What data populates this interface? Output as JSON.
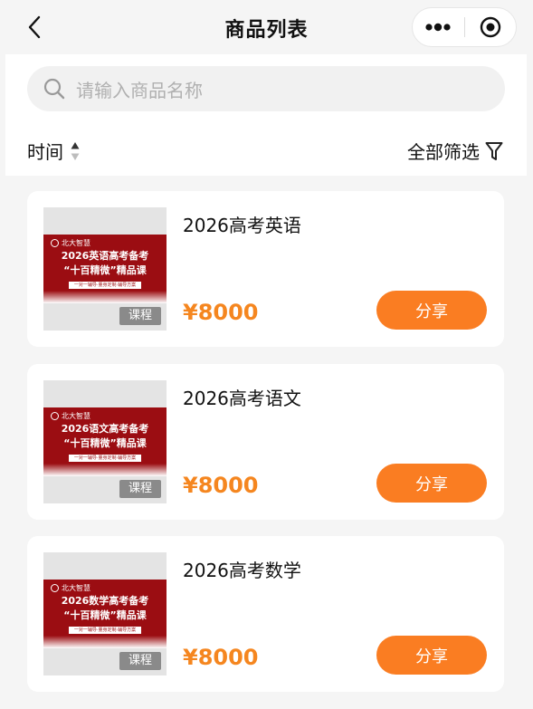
{
  "nav": {
    "title": "商品列表"
  },
  "search": {
    "placeholder": "请输入商品名称"
  },
  "toolbar": {
    "sort_label": "时间",
    "filter_label": "全部筛选"
  },
  "colors": {
    "accent": "#fa7d22",
    "price": "#f5861f",
    "banner": "#9b0d12"
  },
  "products": [
    {
      "title": "2026高考英语",
      "price": "¥8000",
      "tag": "课程",
      "share_label": "分享",
      "banner": {
        "logo": "北大智慧",
        "line1": "2026英语高考备考",
        "line2": "“十百精微”精品课",
        "tagline": "一对一辅导·量身定制·辅导方案"
      }
    },
    {
      "title": "2026高考语文",
      "price": "¥8000",
      "tag": "课程",
      "share_label": "分享",
      "banner": {
        "logo": "北大智慧",
        "line1": "2026语文高考备考",
        "line2": "“十百精微”精品课",
        "tagline": "一对一辅导·量身定制·辅导方案"
      }
    },
    {
      "title": "2026高考数学",
      "price": "¥8000",
      "tag": "课程",
      "share_label": "分享",
      "banner": {
        "logo": "北大智慧",
        "line1": "2026数学高考备考",
        "line2": "“十百精微”精品课",
        "tagline": "一对一辅导·量身定制·辅导方案"
      }
    }
  ]
}
